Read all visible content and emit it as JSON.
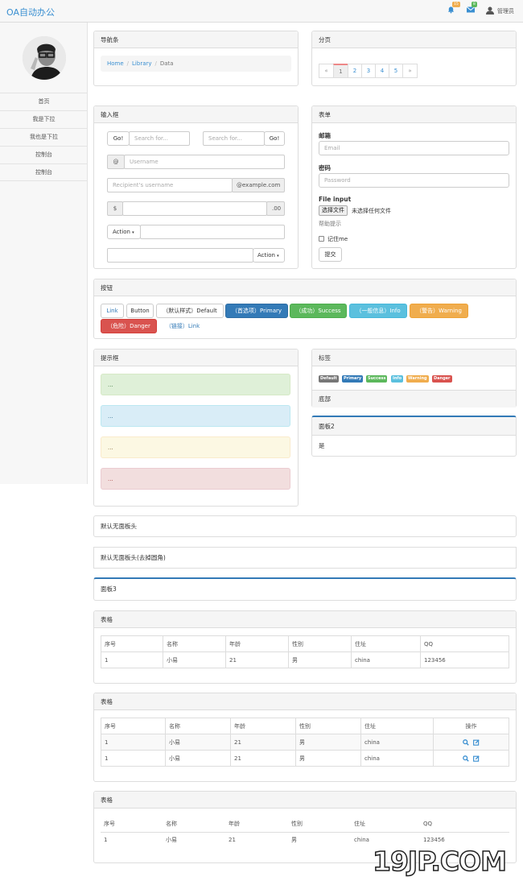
{
  "app": {
    "title": "OA自动办公"
  },
  "topbar": {
    "bell_count": "15",
    "mail_count": "8",
    "user": "管理员"
  },
  "sidebar": {
    "items": [
      {
        "label": "首页"
      },
      {
        "label": "我是下拉"
      },
      {
        "label": "我也是下拉"
      },
      {
        "label": "控制台"
      },
      {
        "label": "控制台"
      }
    ]
  },
  "breadcrumb_panel": {
    "title": "导航条",
    "items": [
      "Home",
      "Library",
      "Data"
    ]
  },
  "pagination_panel": {
    "title": "分页",
    "prev": "«",
    "pages": [
      "1",
      "2",
      "3",
      "4",
      "5"
    ],
    "next": "»",
    "active": "1"
  },
  "input_panel": {
    "title": "输入框",
    "go_label": "Go!",
    "search_placeholder": "Search for...",
    "at": "@",
    "username_placeholder": "Username",
    "recipient_placeholder": "Recipient's username",
    "example_suffix": "@example.com",
    "dollar": "$",
    "cents": ".00",
    "action_label": "Action"
  },
  "form_panel": {
    "title": "表单",
    "email_label": "邮箱",
    "email_placeholder": "Email",
    "password_label": "密码",
    "password_placeholder": "Password",
    "file_label": "File input",
    "file_button": "选择文件",
    "file_status": "未选择任何文件",
    "help": "帮助提示",
    "remember": "记住me",
    "submit": "提交"
  },
  "buttons_panel": {
    "title": "按钮",
    "buttons": [
      "Link",
      "Button",
      "（默认样式）Default",
      "（首选项）Primary",
      "（成功）Success",
      "（一般信息）Info",
      "（警告）Warning",
      "（危险）Danger",
      "（链接）Link"
    ]
  },
  "alerts_panel": {
    "title": "提示框",
    "alerts": [
      "...",
      "...",
      "...",
      "..."
    ]
  },
  "labels_panel": {
    "title": "标签",
    "labels": [
      "Default",
      "Primary",
      "Success",
      "Info",
      "Warning",
      "Danger"
    ],
    "footer": "底部"
  },
  "panel2": {
    "title": "面板2",
    "body": "是"
  },
  "plain_panels": [
    "默认无面板头",
    "默认无面板头(去掉圆角)",
    "面板3"
  ],
  "table1": {
    "title": "表格",
    "headers": [
      "序号",
      "名称",
      "年龄",
      "性别",
      "住址",
      "QQ"
    ],
    "rows": [
      [
        "1",
        "小易",
        "21",
        "男",
        "china",
        "123456"
      ]
    ]
  },
  "table2": {
    "title": "表格",
    "headers": [
      "序号",
      "名称",
      "年龄",
      "性别",
      "住址",
      "操作"
    ],
    "rows": [
      [
        "1",
        "小易",
        "21",
        "男",
        "china"
      ],
      [
        "1",
        "小易",
        "21",
        "男",
        "china"
      ]
    ]
  },
  "table3": {
    "title": "表格",
    "headers": [
      "序号",
      "名称",
      "年龄",
      "性别",
      "住址",
      "QQ"
    ],
    "rows": [
      [
        "1",
        "小易",
        "21",
        "男",
        "china",
        "123456"
      ]
    ]
  },
  "watermark": "19JP.COM",
  "colors": {
    "primary": "#337ab7",
    "success": "#5cb85c",
    "info": "#5bc0de",
    "warning": "#f0ad4e",
    "danger": "#d9534f",
    "default": "#777777",
    "brand": "#3a8fd1"
  }
}
